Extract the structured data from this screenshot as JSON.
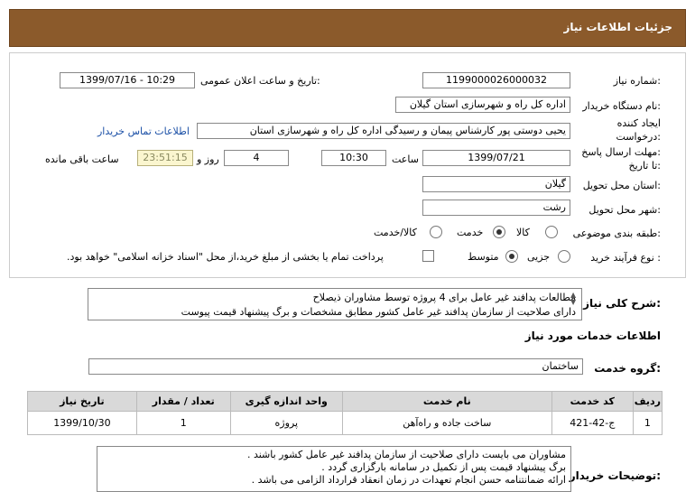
{
  "header": {
    "title": "جزئیات اطلاعات نیاز"
  },
  "form": {
    "need_number_label": "شماره نیاز:",
    "need_number": "1199000026000032",
    "announce_label": "تاریخ و ساعت اعلان عمومی:",
    "announce_value": "1399/07/16 - 10:29",
    "buyer_label": "نام دستگاه خریدار:",
    "buyer_value": "اداره کل راه و شهرسازی استان گیلان",
    "creator_label_1": "ایجاد کننده",
    "creator_label_2": "درخواست:",
    "creator_value": "یحیی دوستی پور کارشناس پیمان و رسیدگی اداره کل راه و شهرسازی استان",
    "contact_link": "اطلاعات تماس خریدار",
    "deadline_label_1": "مهلت ارسال پاسخ:",
    "deadline_label_2": "تا تاریخ:",
    "deadline_date": "1399/07/21",
    "time_label": "ساعت",
    "deadline_time": "10:30",
    "days_value": "4",
    "days_label": "روز و",
    "remaining_time": "23:51:15",
    "remaining_label": "ساعت باقی مانده",
    "province_label": "استان محل تحویل:",
    "province_value": "گیلان",
    "city_label": "شهر محل تحویل:",
    "city_value": "رشت",
    "category_label": "طبقه بندی موضوعی:",
    "category_options": [
      "کالا",
      "خدمت",
      "کالا/خدمت"
    ],
    "category_selected": "خدمت",
    "process_label": "نوع فرآیند خرید :",
    "process_options": [
      "جزیی",
      "متوسط"
    ],
    "process_selected": "متوسط",
    "payment_note": "پرداخت تمام یا بخشی از مبلغ خرید،از محل \"اسناد خزانه اسلامی\" خواهد بود."
  },
  "description": {
    "label": "شرح کلی نیاز:",
    "line1": "مطالعات پدافند غیر عامل برای 4 پروژه توسط مشاوران ذیصلاح",
    "line2": "دارای صلاحیت از سازمان پدافند غیر عامل کشور مطابق مشخصات و برگ پیشنهاد قیمت پیوست"
  },
  "services": {
    "section_title": "اطلاعات خدمات مورد نیاز",
    "group_label": "گروه خدمت:",
    "group_value": "ساختمان",
    "columns": [
      "ردیف",
      "کد خدمت",
      "نام خدمت",
      "واحد اندازه گیری",
      "تعداد / مقدار",
      "تاریخ نیاز"
    ],
    "rows": [
      {
        "index": "1",
        "code": "ج-42-421",
        "name": "ساخت جاده و راه‌آهن",
        "unit": "پروژه",
        "qty": "1",
        "date": "1399/10/30"
      }
    ]
  },
  "buyer_notes": {
    "label": "توضیحات خریدار:",
    "line1": "مشاوران می بایست دارای صلاحیت از سازمان پدافند غیر عامل کشور باشند .",
    "line2": "برگ پیشنهاد قیمت پس از تکمیل در سامانه بارگزاری گردد .",
    "line3": "ارائه ضمانتنامه حسن انجام تعهدات در زمان انعقاد قرارداد الزامی می باشد ."
  }
}
